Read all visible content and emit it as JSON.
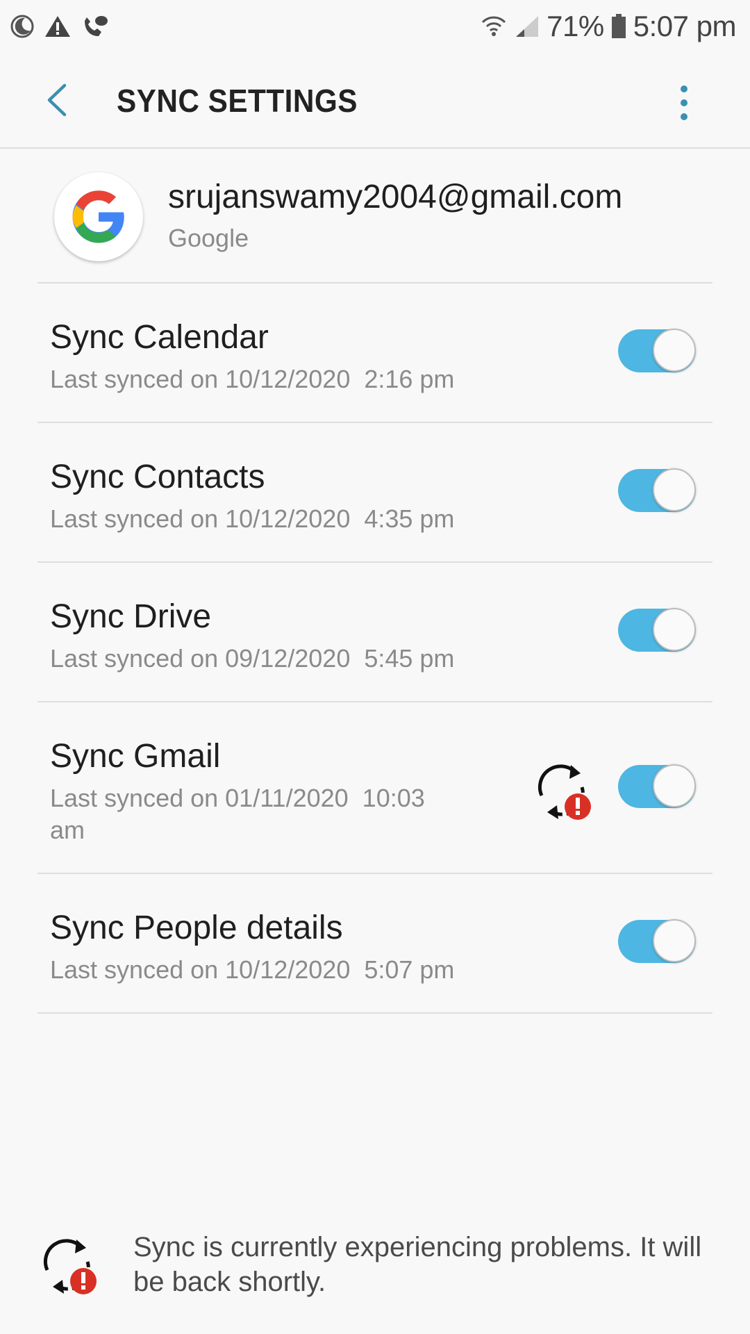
{
  "status_bar": {
    "battery": "71%",
    "time": "5:07 pm",
    "icons": [
      "moon-icon",
      "warning-icon",
      "voicemail-icon",
      "wifi-icon",
      "signal-icon",
      "battery-icon"
    ]
  },
  "header": {
    "title": "SYNC SETTINGS"
  },
  "account": {
    "email": "srujanswamy2004@gmail.com",
    "type": "Google"
  },
  "sync_items": [
    {
      "title": "Sync Calendar",
      "subtitle": "Last synced on 10/12/2020  2:16 pm",
      "enabled": true
    },
    {
      "title": "Sync Contacts",
      "subtitle": "Last synced on 10/12/2020  4:35 pm",
      "enabled": true
    },
    {
      "title": "Sync Drive",
      "subtitle": "Last synced on 09/12/2020  5:45 pm",
      "enabled": true
    },
    {
      "title": "Sync Gmail",
      "subtitle": "Last synced on 01/11/2020  10:03\nam",
      "enabled": true,
      "error": true
    },
    {
      "title": "Sync People details",
      "subtitle": "Last synced on 10/12/2020  5:07 pm",
      "enabled": true
    }
  ],
  "footer": {
    "message": "Sync is currently experiencing problems. It will be back shortly."
  },
  "colors": {
    "accent": "#4db6e2",
    "back_arrow": "#3c8fb0",
    "error": "#d93025"
  }
}
